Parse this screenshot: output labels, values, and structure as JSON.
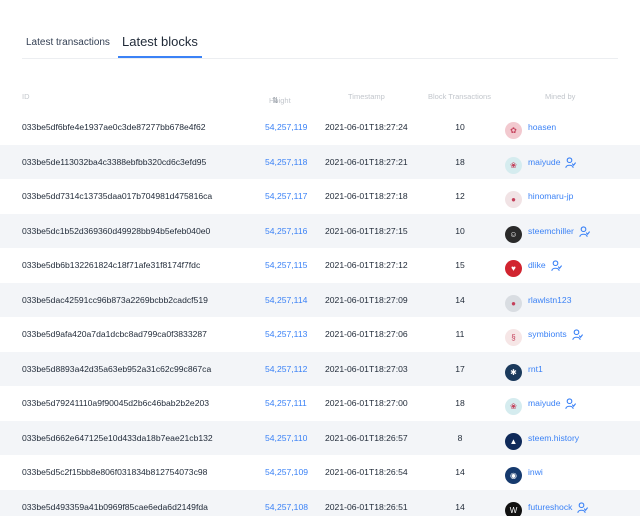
{
  "tabs": [
    {
      "label": "Latest transactions"
    },
    {
      "label": "Latest blocks"
    }
  ],
  "table": {
    "headers": {
      "id": "ID",
      "height": "Height",
      "timestamp": "Timestamp",
      "tx": "Block Transactions",
      "miner": "Mined by"
    },
    "rows": [
      {
        "id": "033be5df6bfe4e1937ae0c3de87277bb678e4f62",
        "height": "54,257,119",
        "timestamp": "2021-06-01T18:27:24",
        "tx": "10",
        "miner": "hoasen",
        "avatar_icon": "lotus-avatar-icon",
        "avatar_color": "#f2c9cf",
        "avatar_glyph": "✿",
        "badge": false
      },
      {
        "id": "033be5de113032ba4c3388ebfbb320cd6c3efd95",
        "height": "54,257,118",
        "timestamp": "2021-06-01T18:27:21",
        "tx": "18",
        "miner": "maiyude",
        "avatar_icon": "teal-logo-avatar-icon",
        "avatar_color": "#d5ecef",
        "avatar_glyph": "❀",
        "badge": true
      },
      {
        "id": "033be5dd7314c13735daa017b704981d475816ca",
        "height": "54,257,117",
        "timestamp": "2021-06-01T18:27:18",
        "tx": "12",
        "miner": "hinomaru-jp",
        "avatar_icon": "flag-avatar-icon",
        "avatar_color": "#f1e3e5",
        "avatar_glyph": "●",
        "badge": false
      },
      {
        "id": "033be5dc1b52d369360d49928bb94b5efeb040e0",
        "height": "54,257,116",
        "timestamp": "2021-06-01T18:27:15",
        "tx": "10",
        "miner": "steemchiller",
        "avatar_icon": "portrait-avatar-icon",
        "avatar_color": "#2a2a2a",
        "avatar_glyph": "☺",
        "badge": true
      },
      {
        "id": "033be5db6b132261824c18f71afe31f8174f7fdc",
        "height": "54,257,115",
        "timestamp": "2021-06-01T18:27:12",
        "tx": "15",
        "miner": "dlike",
        "avatar_icon": "heart-avatar-icon",
        "avatar_color": "#d1242f",
        "avatar_glyph": "♥",
        "badge": true
      },
      {
        "id": "033be5dac42591cc96b873a2269bcbb2cadcf519",
        "height": "54,257,114",
        "timestamp": "2021-06-01T18:27:09",
        "tx": "14",
        "miner": "rlawlstn123",
        "avatar_icon": "default-user-avatar-icon",
        "avatar_color": "#d9dde2",
        "avatar_glyph": "●",
        "badge": false
      },
      {
        "id": "033be5d9afa420a7da1dcbc8ad799ca0f3833287",
        "height": "54,257,113",
        "timestamp": "2021-06-01T18:27:06",
        "tx": "11",
        "miner": "symbionts",
        "avatar_icon": "bracket-avatar-icon",
        "avatar_color": "#f6e6e6",
        "avatar_glyph": "§",
        "badge": true
      },
      {
        "id": "033be5d8893a42d35a63eb952a31c62c99c867ca",
        "height": "54,257,112",
        "timestamp": "2021-06-01T18:27:03",
        "tx": "17",
        "miner": "rnt1",
        "avatar_icon": "bulb-avatar-icon",
        "avatar_color": "#1b3a5c",
        "avatar_glyph": "✱",
        "badge": false
      },
      {
        "id": "033be5d79241110a9f90045d2b6c46bab2b2e203",
        "height": "54,257,111",
        "timestamp": "2021-06-01T18:27:00",
        "tx": "18",
        "miner": "maiyude",
        "avatar_icon": "teal-logo-avatar-icon",
        "avatar_color": "#d5ecef",
        "avatar_glyph": "❀",
        "badge": true
      },
      {
        "id": "033be5d662e647125e10d433da18b7eae21cb132",
        "height": "54,257,110",
        "timestamp": "2021-06-01T18:26:57",
        "tx": "8",
        "miner": "steem.history",
        "avatar_icon": "silhouette-avatar-icon",
        "avatar_color": "#0f2a5a",
        "avatar_glyph": "▲",
        "badge": false
      },
      {
        "id": "033be5d5c2f15bb8e806f031834b812754073c98",
        "height": "54,257,109",
        "timestamp": "2021-06-01T18:26:54",
        "tx": "14",
        "miner": "inwi",
        "avatar_icon": "circle-logo-avatar-icon",
        "avatar_color": "#163a6e",
        "avatar_glyph": "◉",
        "badge": false
      },
      {
        "id": "033be5d493359a41b0969f85cae6eda6d2149fda",
        "height": "54,257,108",
        "timestamp": "2021-06-01T18:26:51",
        "tx": "14",
        "miner": "futureshock",
        "avatar_icon": "w-logo-avatar-icon",
        "avatar_color": "#111111",
        "avatar_glyph": "W",
        "badge": true
      }
    ]
  },
  "colors": {
    "accent": "#3b82f6",
    "row_alt": "#f3f5f8"
  }
}
